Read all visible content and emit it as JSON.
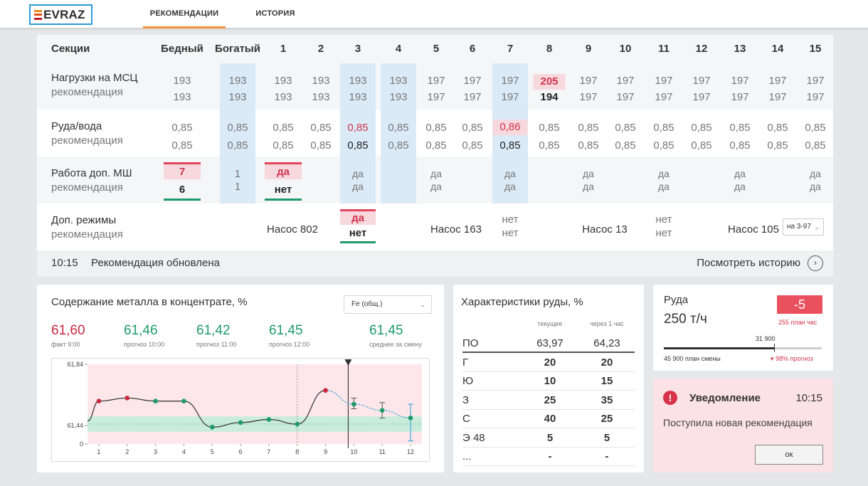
{
  "brand": {
    "logo_text": "EVRAZ"
  },
  "nav": {
    "tab_recommendations": "РЕКОМЕНДАЦИИ",
    "tab_history": "ИСТОРИЯ"
  },
  "table": {
    "headers": [
      "Секции",
      "Бедный",
      "Богатый",
      "1",
      "2",
      "3",
      "4",
      "5",
      "6",
      "7",
      "8",
      "9",
      "10",
      "11",
      "12",
      "13",
      "14",
      "15"
    ],
    "rows": {
      "load": {
        "label": "Нагрузки на МСЦ",
        "sub": "рекомендация",
        "values": [
          "193",
          "193",
          "193",
          "193",
          "193",
          "193",
          "197",
          "197",
          "197",
          "205",
          "197",
          "197",
          "197",
          "197",
          "197",
          "197",
          "197"
        ],
        "recs": [
          "193",
          "193",
          "193",
          "193",
          "193",
          "193",
          "197",
          "197",
          "197",
          "194",
          "197",
          "197",
          "197",
          "197",
          "197",
          "197",
          "197"
        ]
      },
      "ore_water": {
        "label": "Руда/вода",
        "sub": "рекомендация",
        "values": [
          "0,85",
          "0,85",
          "0,85",
          "0,85",
          "0,85",
          "0,85",
          "0,85",
          "0,85",
          "0,86",
          "0,85",
          "0,85",
          "0,85",
          "0,85",
          "0,85",
          "0,85",
          "0,85",
          "0,85"
        ],
        "recs": [
          "0,85",
          "0,85",
          "0,85",
          "0,85",
          "0,85",
          "0,85",
          "0,85",
          "0,85",
          "0,85",
          "0,85",
          "0,85",
          "0,85",
          "0,85",
          "0,85",
          "0,85",
          "0,85",
          "0,85"
        ]
      },
      "extra_mill": {
        "label": "Работа доп. МШ",
        "sub": "рекомендация",
        "cells": [
          {
            "col": 1,
            "value": "7",
            "rec": "6"
          },
          {
            "col": 2,
            "value": "1",
            "rec": "1"
          },
          {
            "col": 3,
            "value": "да",
            "rec": "нет"
          },
          {
            "col": 5,
            "value": "да",
            "rec": "да"
          },
          {
            "col": 7,
            "value": "да",
            "rec": "да"
          },
          {
            "col": 9,
            "value": "да",
            "rec": "да"
          },
          {
            "col": 11,
            "value": "да",
            "rec": "да"
          },
          {
            "col": 13,
            "value": "да",
            "rec": "да"
          },
          {
            "col": 15,
            "value": "да",
            "rec": "да"
          },
          {
            "col": 17,
            "value": "да",
            "rec": "да"
          }
        ]
      },
      "extra_modes": {
        "label": "Доп. режимы",
        "sub": "рекомендация",
        "pump1": "Насос 802",
        "mode_val": "да",
        "mode_rec": "нет",
        "pump2": "Насос 163",
        "no1_val": "нет",
        "no1_rec": "нет",
        "pump3": "Насос 13",
        "no2_val": "нет",
        "no2_rec": "нет",
        "pump4": "Насос 105",
        "select_value": "на 3-97"
      }
    },
    "footer": {
      "time": "10:15",
      "message": "Рекомендация обновлена",
      "link": "Посмотреть историю"
    }
  },
  "metal": {
    "title": "Содержание металла в концентрате, %",
    "select_value": "Fe (общ.)",
    "kpis": [
      {
        "value": "61,60",
        "label": "факт 9:00",
        "color": "#c8283f"
      },
      {
        "value": "61,46",
        "label": "прогноз 10:00",
        "color": "#1f9a6a"
      },
      {
        "value": "61,42",
        "label": "прогноз 11:00",
        "color": "#1f9a6a"
      },
      {
        "value": "61,45",
        "label": "прогноз 12:00",
        "color": "#1f9a6a"
      },
      {
        "value": "61,45",
        "label": "среднее за смену",
        "color": "#1f9a6a"
      }
    ]
  },
  "chart_data": {
    "type": "line",
    "title": "",
    "xlabel": "",
    "ylabel": "",
    "x": [
      1,
      2,
      3,
      4,
      5,
      6,
      7,
      8,
      9,
      10,
      11,
      12
    ],
    "y_tick_labels": [
      "61,84",
      "61,44",
      "0"
    ],
    "ylim": [
      61.32,
      61.84
    ],
    "norm_band": [
      61.4,
      61.5
    ],
    "series": [
      {
        "values": [
          61.6,
          61.62,
          61.6,
          61.6,
          61.43,
          61.46,
          61.48,
          61.45,
          61.67,
          61.58,
          61.54,
          61.49
        ],
        "actual_points": 9,
        "forecast_points": 3
      }
    ],
    "error_bars": [
      {
        "x": 10,
        "lo": 61.55,
        "hi": 61.62
      },
      {
        "x": 11,
        "lo": 61.49,
        "hi": 61.59
      },
      {
        "x": 12,
        "lo": 61.34,
        "hi": 61.58
      }
    ],
    "red_points": [
      1,
      2,
      9
    ],
    "grid": false,
    "colors": {
      "actual": "#3d3d3d",
      "forecast": "#2c9bd8",
      "band": "#c9ecdd",
      "background": "#fde7ea",
      "red": "#c8283f",
      "green": "#1f9a6a"
    }
  },
  "ore_chars": {
    "title": "Характеристики руды, %",
    "col_current": "текущее",
    "col_next": "через 1 час",
    "rows": [
      {
        "name": "ПО",
        "cur": "63,97",
        "next": "64,23"
      },
      {
        "name": "Г",
        "cur": "20",
        "next": "20"
      },
      {
        "name": "Ю",
        "cur": "10",
        "next": "15"
      },
      {
        "name": "З",
        "cur": "25",
        "next": "35"
      },
      {
        "name": "С",
        "cur": "40",
        "next": "25"
      },
      {
        "name": "Э 48",
        "cur": "5",
        "next": "5"
      },
      {
        "name": "...",
        "cur": "-",
        "next": "-"
      }
    ]
  },
  "ruda": {
    "title": "Руда",
    "rate": "250 т/ч",
    "badge": "-5",
    "plan_hour": "255 план час",
    "current_total": "31 900",
    "plan_shift": "45 900 план смены",
    "forecast": "98% прогноз",
    "progress_fraction": 0.7
  },
  "notification": {
    "title": "Уведомление",
    "time": "10:15",
    "message": "Поступила новая рекомендация",
    "ok": "ок"
  }
}
